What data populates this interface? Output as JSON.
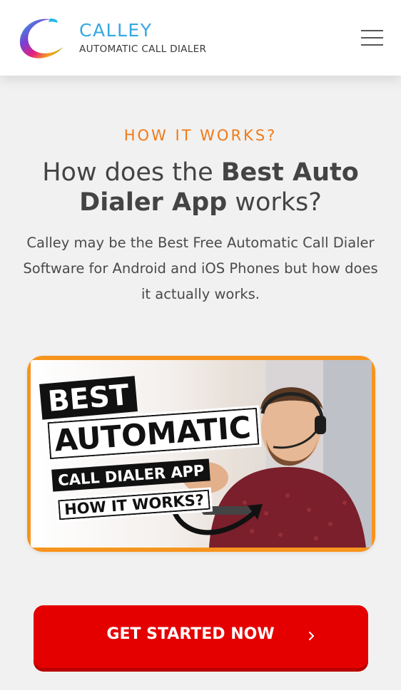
{
  "header": {
    "brand_name": "CALLEY",
    "brand_tagline": "AUTOMATIC CALL DIALER",
    "menu_icon": "hamburger-icon"
  },
  "section": {
    "kicker": "HOW IT WORKS?",
    "headline_part1": "How does the ",
    "headline_bold": "Best Auto Dialer App",
    "headline_part2": " works?",
    "description": "Calley may be the Best Free Automatic Call Dialer Software for Android and iOS Phones but how does it actually works."
  },
  "video": {
    "line1": "BEST",
    "line2": "AUTOMATIC",
    "line3": "CALL DIALER APP",
    "line4": "HOW IT WORKS?"
  },
  "cta": {
    "label": "GET STARTED NOW",
    "icon": "chevron-right-icon"
  },
  "colors": {
    "accent_orange": "#f07a18",
    "brand_blue": "#35a7e2",
    "cta_red": "#e50000",
    "video_frame": "#f7941d"
  }
}
